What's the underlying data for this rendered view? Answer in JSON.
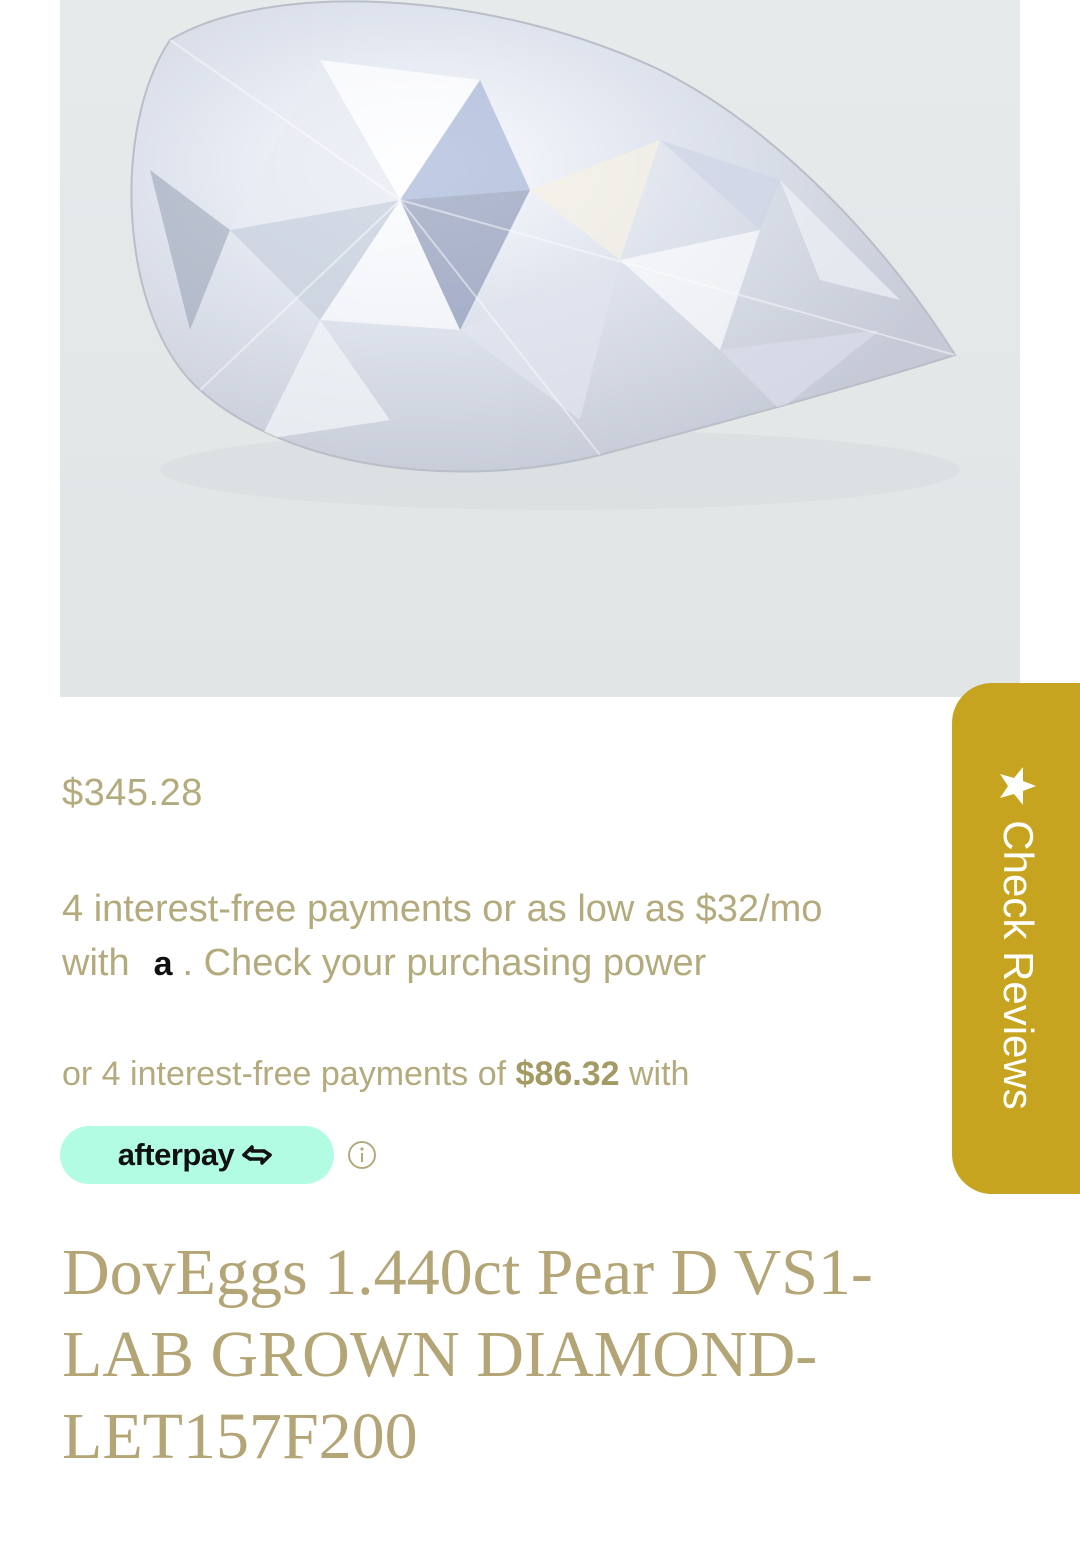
{
  "product": {
    "price": "$345.28",
    "title": "DovEggs 1.440ct Pear D VS1-LAB GROWN DIAMOND-LET157F200",
    "image_alt": "pear-diamond-image"
  },
  "financing": {
    "affirm_text_1": "4 interest-free payments or as low as $32/mo",
    "affirm_with": "with",
    "affirm_logo": "a",
    "affirm_link": ". Check your purchasing power",
    "afterpay_text": "or 4 interest-free payments of ",
    "afterpay_amount": "$86.32",
    "afterpay_with": " with",
    "afterpay_logo": "afterpay"
  },
  "reviews_tab": {
    "label": "Check Reviews",
    "icon": "star-icon"
  },
  "colors": {
    "accent_gold": "#c6a41f",
    "text_khaki": "#b3ab7e",
    "afterpay_mint": "#b2fce4"
  }
}
